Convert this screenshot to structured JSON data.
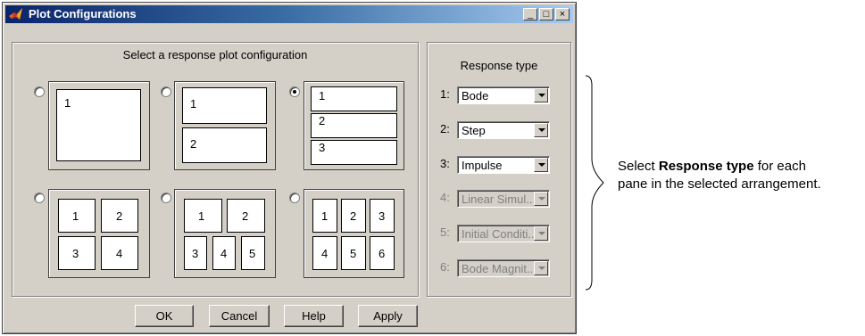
{
  "window": {
    "title": "Plot Configurations",
    "controls": [
      "_",
      "□",
      "×"
    ]
  },
  "config_group": {
    "caption": "Select a response plot configuration",
    "layouts": [
      {
        "selected": false,
        "cells": [
          "1"
        ]
      },
      {
        "selected": false,
        "cells": [
          "1",
          "2"
        ]
      },
      {
        "selected": true,
        "cells": [
          "1",
          "2",
          "3"
        ]
      },
      {
        "selected": false,
        "cells": [
          "1",
          "2",
          "3",
          "4"
        ]
      },
      {
        "selected": false,
        "cells": [
          "1",
          "2",
          "3",
          "4",
          "5"
        ]
      },
      {
        "selected": false,
        "cells": [
          "1",
          "2",
          "3",
          "4",
          "5",
          "6"
        ]
      }
    ]
  },
  "response_group": {
    "caption": "Response type",
    "rows": [
      {
        "num": "1:",
        "value": "Bode",
        "enabled": true
      },
      {
        "num": "2:",
        "value": "Step",
        "enabled": true
      },
      {
        "num": "3:",
        "value": "Impulse",
        "enabled": true
      },
      {
        "num": "4:",
        "value": "Linear Simul...",
        "enabled": false
      },
      {
        "num": "5:",
        "value": "Initial Conditi...",
        "enabled": false
      },
      {
        "num": "6:",
        "value": "Bode Magnit...",
        "enabled": false
      }
    ]
  },
  "buttons": {
    "ok": "OK",
    "cancel": "Cancel",
    "help": "Help",
    "apply": "Apply"
  },
  "annotation": {
    "line1_prefix": "Select ",
    "line1_bold": "Response type",
    "line1_suffix": " for each",
    "line2": "pane in the selected arrangement."
  }
}
